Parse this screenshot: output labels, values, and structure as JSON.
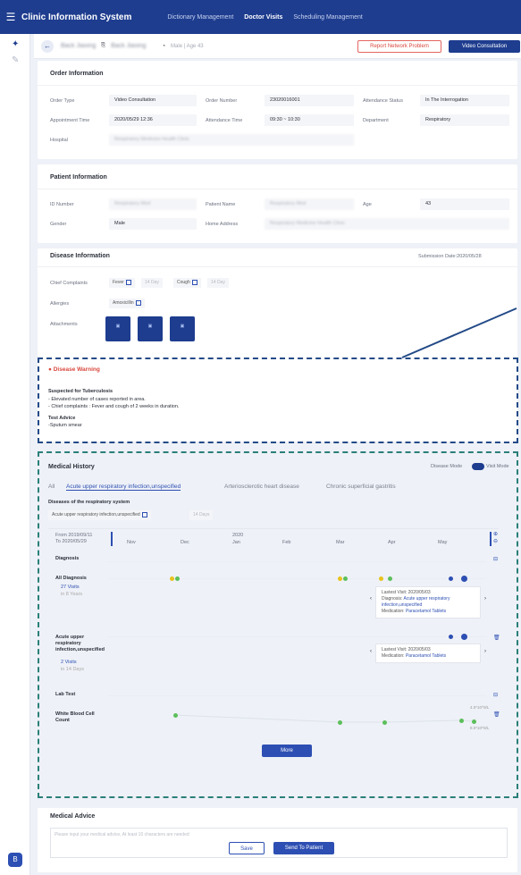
{
  "app": {
    "title": "Clinic Information System",
    "nav": [
      "Dictionary Management",
      "Doctor Visits",
      "Scheduling Management"
    ]
  },
  "header": {
    "patient": "Back Jiaxing",
    "doctor": "Back Jiaxing",
    "meta": "Male | Age 43",
    "report_btn": "Report Network Problem",
    "video_btn": "Video Consultation"
  },
  "order": {
    "title": "Order Information",
    "fields": [
      {
        "label": "Order Type",
        "value": "Video Consultation"
      },
      {
        "label": "Order Number",
        "value": "23020016001"
      },
      {
        "label": "Attendance Status",
        "value": "In The Interrogation"
      },
      {
        "label": "Appointment Time",
        "value": "2020/05/29 12:36"
      },
      {
        "label": "Attendance Time",
        "value": "09:30 ~ 10:30"
      },
      {
        "label": "Department",
        "value": "Respiratory"
      },
      {
        "label": "Hospital",
        "value": "Respiratory Medicine Health Clinic"
      }
    ]
  },
  "patient": {
    "title": "Patient Information",
    "fields": [
      {
        "label": "ID Number",
        "value": "Respiratory Med"
      },
      {
        "label": "Patient Name",
        "value": "Respiratory Med"
      },
      {
        "label": "Age",
        "value": "43"
      },
      {
        "label": "Gender",
        "value": "Male"
      },
      {
        "label": "Home Address",
        "value": "Respiratory Medicine Health Clinic"
      }
    ]
  },
  "disease": {
    "title": "Disease Information",
    "submission": "Submission Date:2020/05/28",
    "chief_label": "Chief Complaints",
    "complaints": [
      {
        "name": "Fever",
        "days": "14 Day"
      },
      {
        "name": "Cough",
        "days": "14 Day"
      }
    ],
    "allergies_label": "Allergies",
    "allergy": "Amoxicillin",
    "attachments_label": "Attachments"
  },
  "warning": {
    "title": "Disease Warning",
    "suspect": "Suspected for Tuberculosis",
    "lines": [
      "- Elevated number of cases reported in area.",
      "- Chief complaints : Fever and cough of 2 weeks in duration."
    ],
    "advice_title": "Test Advice",
    "advice": "-Sputum smear"
  },
  "history": {
    "title": "Medical History",
    "mode": "Disease Mode",
    "visit_mode": "Visit Mode",
    "tabs": [
      "All",
      "Acute upper respiratory infection,unspecified",
      "Arteriosclerotic heart disease",
      "Chronic superficial gastritis"
    ],
    "group": "Diseases of the respiratory system",
    "chip": "Acute upper respiratory infection,unspecified",
    "chip_days": "14 Days",
    "from": "From 2019/09/11",
    "to": "To 2020/05/29",
    "year": "2020",
    "months": [
      "Nov",
      "Dec",
      "Jan",
      "Feb",
      "Mar",
      "Apr",
      "May"
    ],
    "diagnosis": "Diagnosis",
    "all_diag": "All Diagnosis",
    "all_visits": "27 Visits",
    "all_years": "in 8 Years",
    "acute": "Acute upper respiratory infection,unspecified",
    "acute_visits": "2 Visits",
    "acute_days": "in 14 Days",
    "lab": "Lab Test",
    "wbc": "White Blood Cell Count",
    "wbc_v1": "4.0*10^9/L",
    "wbc_v2": "8.0*10^9/L",
    "tip1": {
      "latest": "Lastest Visit: 2020/05/03",
      "diag_label": "Diagnosis:",
      "diag": "Acute upper respiratory infection,unspecified",
      "med_label": "Medication:",
      "med": "Paracetamol Tablets"
    },
    "tip2": {
      "latest": "Lastest Visit: 2020/05/03",
      "med_label": "Medication:",
      "med": "Paracetamol Tablets"
    },
    "more": "More"
  },
  "advice": {
    "title": "Medical Advice",
    "placeholder": "Please input your medical advice, At least 10 characters are needed",
    "save": "Save",
    "send": "Send To Patient"
  },
  "colors": {
    "primary": "#1e3d8f",
    "warn": "#d9483e",
    "yellow": "#e8c21c",
    "green": "#5cbf5a",
    "blue": "#2d4fb3"
  }
}
